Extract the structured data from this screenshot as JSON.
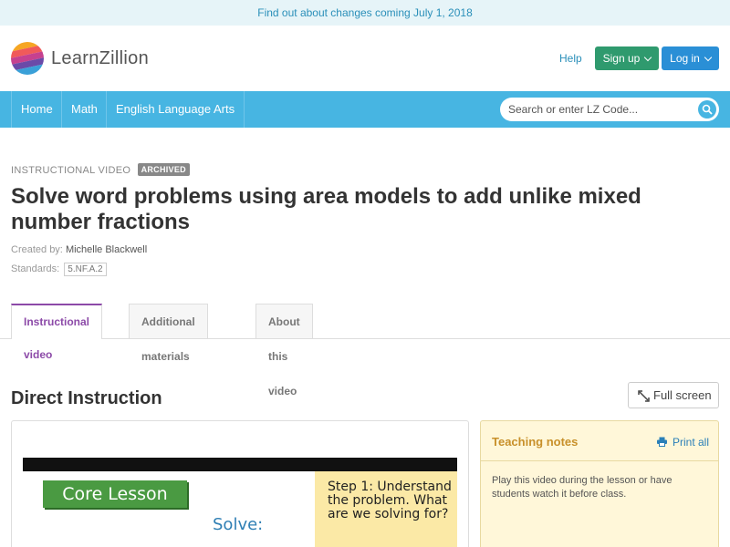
{
  "banner": {
    "text": "Find out about changes coming July 1, 2018"
  },
  "header": {
    "logo_text": "LearnZillion",
    "help": "Help",
    "signup": "Sign up",
    "login": "Log in"
  },
  "nav": {
    "items": [
      {
        "label": "Home"
      },
      {
        "label": "Math"
      },
      {
        "label": "English Language Arts"
      }
    ],
    "search_placeholder": "Search or enter LZ Code..."
  },
  "lesson": {
    "kicker": "INSTRUCTIONAL VIDEO",
    "badge": "ARCHIVED",
    "title": "Solve word problems using area models to add unlike mixed number fractions",
    "created_by_label": "Created by:",
    "author": "Michelle Blackwell",
    "standards_label": "Standards:",
    "standard": "5.NF.A.2"
  },
  "tabs": [
    {
      "label": "Instructional video",
      "active": true
    },
    {
      "label": "Additional materials",
      "active": false
    },
    {
      "label": "About this video",
      "active": false
    }
  ],
  "section": {
    "title": "Direct Instruction",
    "fullscreen": "Full screen"
  },
  "video": {
    "core_lesson": "Core Lesson",
    "solve": "Solve:",
    "step_text": "Step 1: Understand the problem. What are we solving for?"
  },
  "notes": {
    "title": "Teaching notes",
    "print": "Print all",
    "body": "Play this video during the lesson or have students watch it before class."
  },
  "colors": {
    "accent_blue": "#47b5e2",
    "signup_green": "#2f9a6e",
    "login_blue": "#2a8fd6",
    "active_tab_purple": "#8c4aa8",
    "notes_orange": "#c8902a"
  }
}
